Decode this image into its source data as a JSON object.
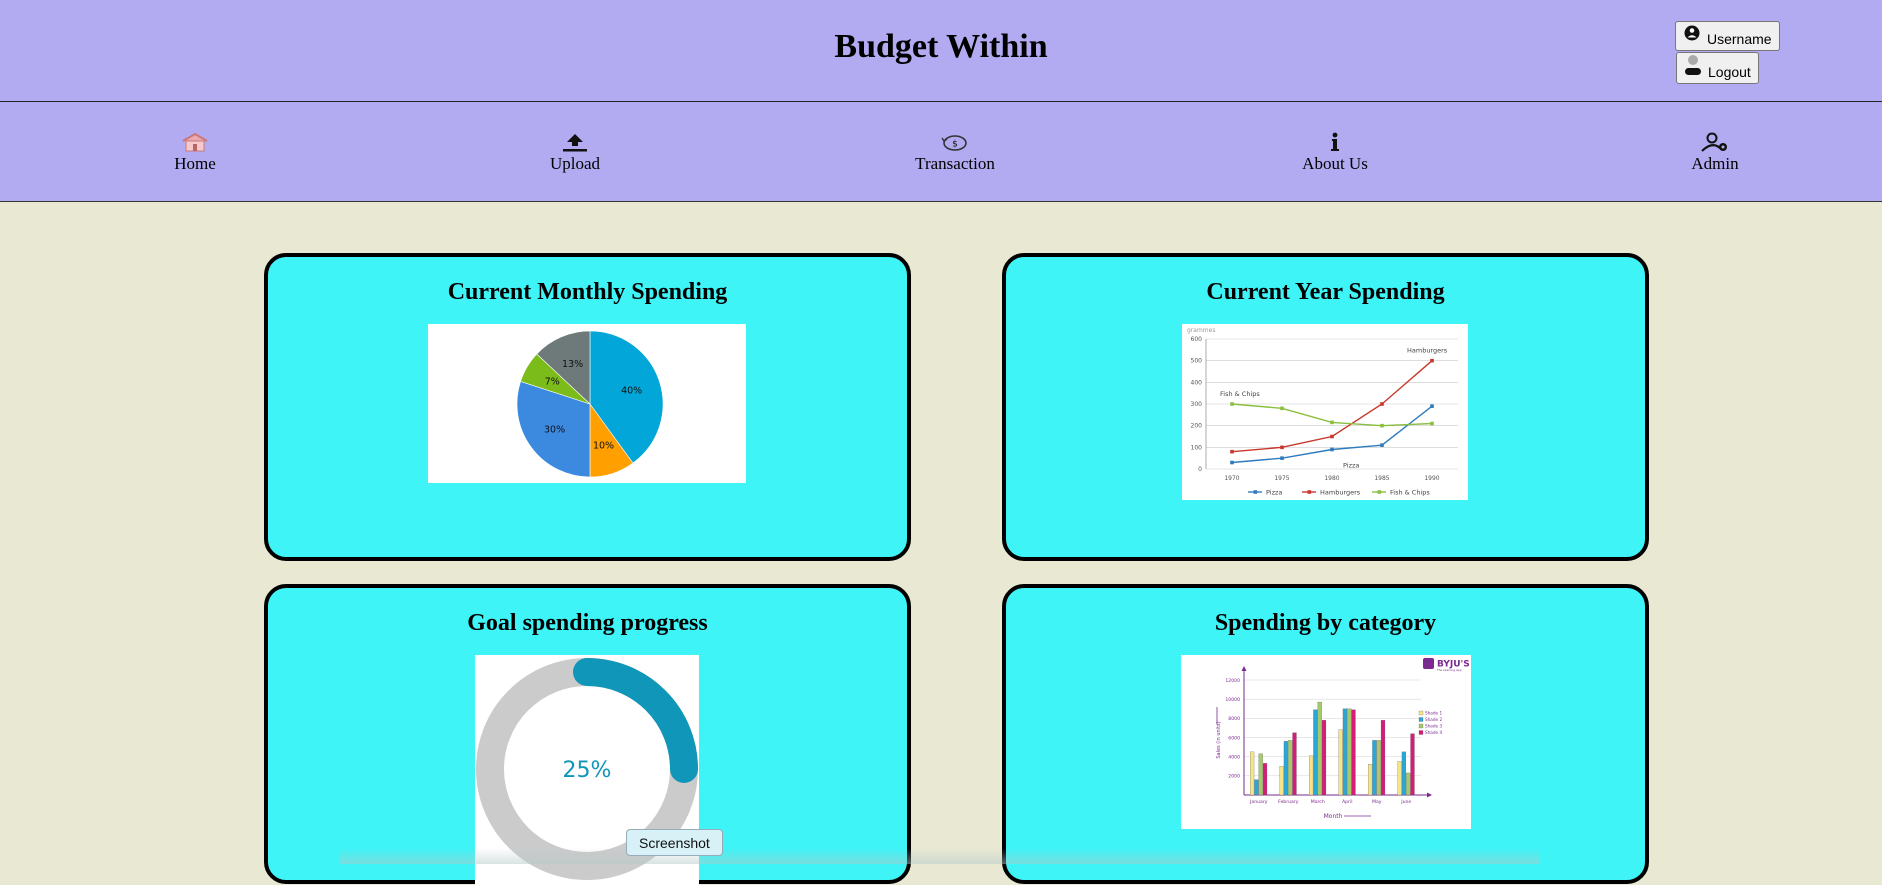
{
  "header": {
    "title": "Budget Within",
    "username_label": "Username",
    "logout_label": "Logout"
  },
  "nav": [
    {
      "label": "Home",
      "icon": "home-icon"
    },
    {
      "label": "Upload",
      "icon": "upload-icon"
    },
    {
      "label": "Transaction",
      "icon": "transaction-icon"
    },
    {
      "label": "About Us",
      "icon": "info-icon"
    },
    {
      "label": "Admin",
      "icon": "admin-icon"
    }
  ],
  "cards": {
    "monthly": {
      "title": "Current Monthly Spending"
    },
    "year": {
      "title": "Current Year Spending"
    },
    "goal": {
      "title": "Goal spending progress"
    },
    "category": {
      "title": "Spending by category"
    }
  },
  "tooltip": "Screenshot",
  "colors": {
    "header_bg": "#b2abf1",
    "page_bg": "#e9e9d3",
    "card_bg": "#3ef4f7",
    "accent": "#0f96b8"
  },
  "chart_data": [
    {
      "type": "pie",
      "labels": [
        "40%",
        "10%",
        "30%",
        "7%",
        "13%"
      ],
      "values": [
        40,
        10,
        30,
        7,
        13
      ],
      "colors": [
        "#03a6d8",
        "#ff9f00",
        "#3b8ae0",
        "#7bbb1a",
        "#6e7a7a"
      ]
    },
    {
      "type": "line",
      "title": "",
      "ylabel": "grammes",
      "x": [
        1970,
        1975,
        1980,
        1985,
        1990
      ],
      "ylim": [
        0,
        600
      ],
      "yticks": [
        0,
        100,
        200,
        300,
        400,
        500,
        600
      ],
      "series": [
        {
          "name": "Pizza",
          "values": [
            30,
            50,
            90,
            110,
            290
          ],
          "color": "#2f7bbf"
        },
        {
          "name": "Hamburgers",
          "values": [
            80,
            100,
            150,
            300,
            500
          ],
          "color": "#c8362c"
        },
        {
          "name": "Fish & Chips",
          "values": [
            300,
            280,
            215,
            200,
            210
          ],
          "color": "#8bbf3f"
        }
      ],
      "annotations": [
        "Hamburgers",
        "Fish & Chips",
        "Pizza"
      ]
    },
    {
      "type": "donut",
      "label": "25%",
      "progress": 0.25,
      "color": "#0f96b8",
      "track_color": "#cbcbcb"
    },
    {
      "type": "bar",
      "logo": "BYJU'S",
      "logo_sub": "The Learning App",
      "xlabel": "Month",
      "ylabel": "Sales (in units)",
      "categories": [
        "January",
        "February",
        "March",
        "April",
        "May",
        "June"
      ],
      "ylim": [
        0,
        12000
      ],
      "yticks": [
        2000,
        4000,
        6000,
        8000,
        10000,
        12000
      ],
      "series": [
        {
          "name": "Shade 1",
          "values": [
            4500,
            3000,
            4100,
            6800,
            3200,
            3500
          ],
          "color": "#f7e38a"
        },
        {
          "name": "Shade 2",
          "values": [
            1600,
            5600,
            8900,
            9000,
            5700,
            4500
          ],
          "color": "#29a7d8"
        },
        {
          "name": "Shade 3",
          "values": [
            4300,
            5700,
            9700,
            9000,
            5700,
            2300
          ],
          "color": "#a5c96b"
        },
        {
          "name": "Shade 4",
          "values": [
            3300,
            6500,
            7800,
            8900,
            7800,
            6400
          ],
          "color": "#d61c78"
        }
      ]
    }
  ]
}
